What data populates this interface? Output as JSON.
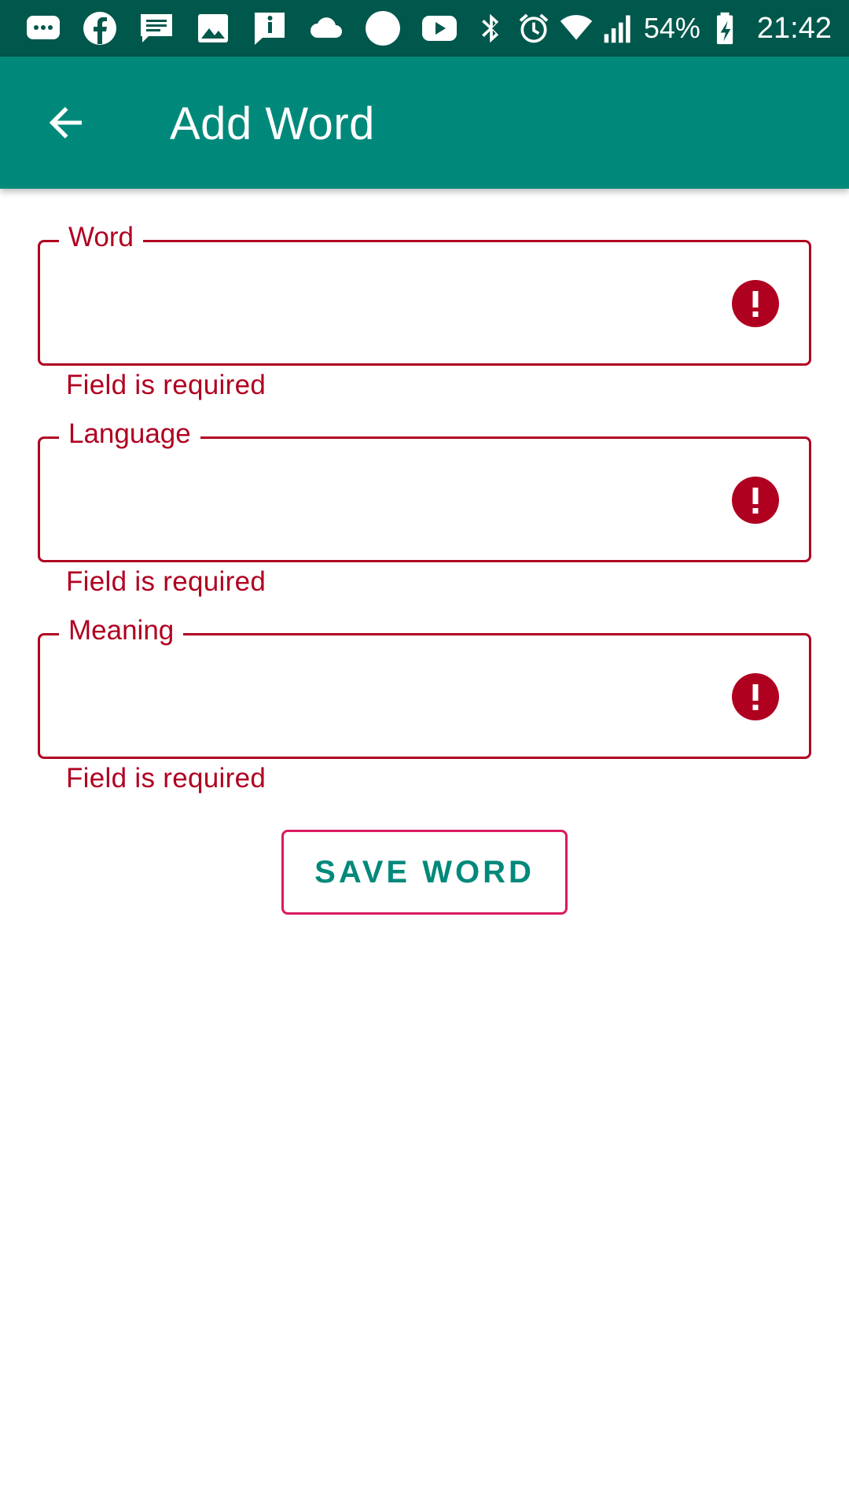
{
  "status_bar": {
    "icons": [
      "messages-icon",
      "facebook-icon",
      "chat-icon",
      "image-icon",
      "info-message-icon",
      "cloud-icon",
      "circle-icon",
      "youtube-icon"
    ],
    "right_icons": [
      "bluetooth-icon",
      "alarm-icon",
      "wifi-icon",
      "signal-icon",
      "battery-icon"
    ],
    "battery_percent": "54%",
    "time": "21:42"
  },
  "app_bar": {
    "title": "Add Word",
    "back_icon": "arrow-back-icon"
  },
  "form": {
    "fields": [
      {
        "label": "Word",
        "value": "",
        "helper": "Field is required"
      },
      {
        "label": "Language",
        "value": "",
        "helper": "Field is required"
      },
      {
        "label": "Meaning",
        "value": "",
        "helper": "Field is required"
      }
    ],
    "save_label": "SAVE WORD"
  },
  "colors": {
    "status_bar": "#00574b",
    "app_bar": "#00897b",
    "error": "#b00020",
    "button_border": "#d81b60",
    "button_text": "#00897b"
  }
}
